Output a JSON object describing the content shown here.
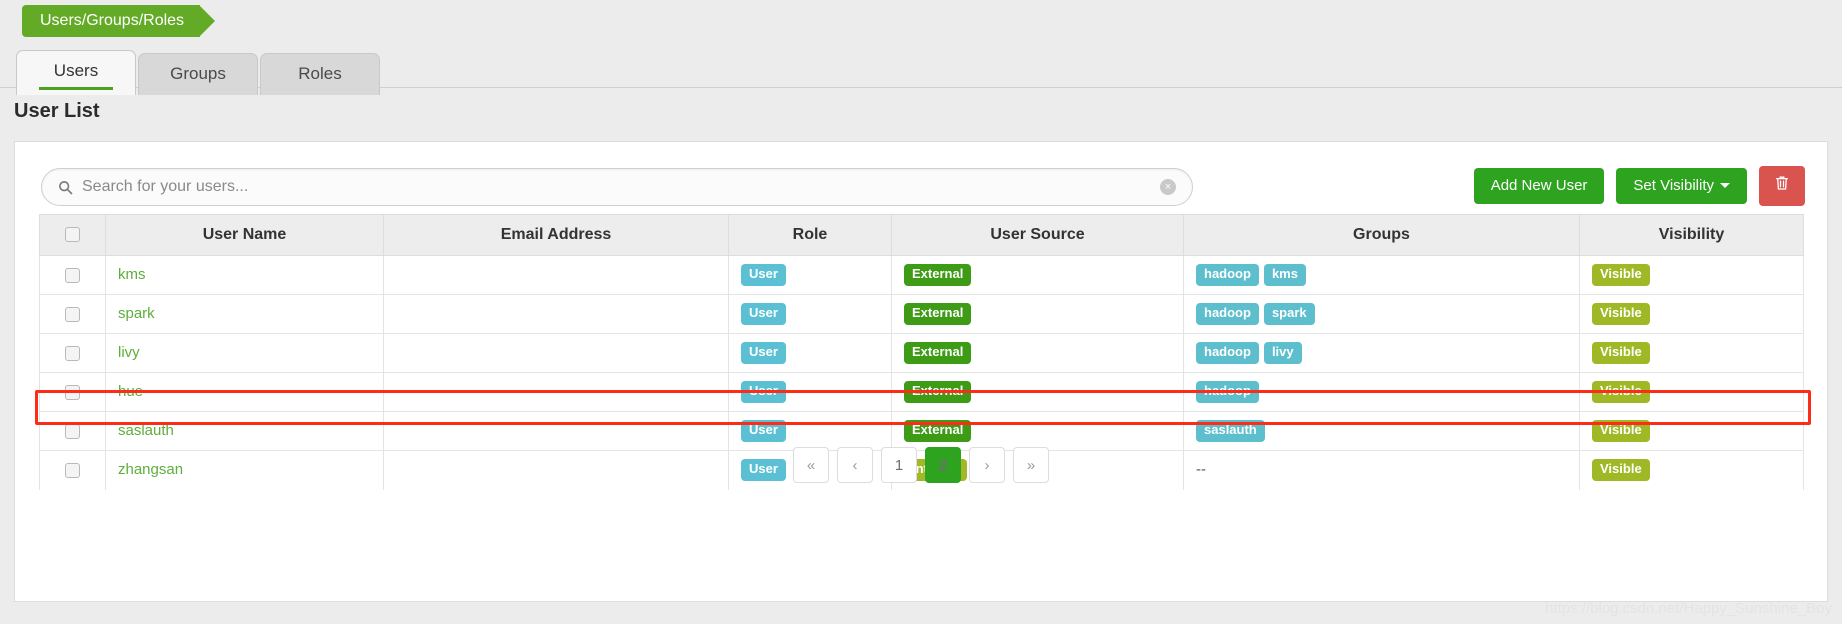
{
  "breadcrumb": {
    "label": "Users/Groups/Roles"
  },
  "tabs": [
    {
      "label": "Users",
      "active": true
    },
    {
      "label": "Groups",
      "active": false
    },
    {
      "label": "Roles",
      "active": false
    }
  ],
  "page_title": "User List",
  "search": {
    "placeholder": "Search for your users...",
    "value": "",
    "icon": "search-icon",
    "clear_icon": "×"
  },
  "toolbar": {
    "add_user_label": "Add New User",
    "set_visibility_label": "Set Visibility",
    "delete_icon": "trash-icon"
  },
  "table": {
    "columns": [
      "",
      "User Name",
      "Email Address",
      "Role",
      "User Source",
      "Groups",
      "Visibility"
    ],
    "rows": [
      {
        "user": "kms",
        "email": "",
        "role": "User",
        "source": "External",
        "source_kind": "external",
        "groups": [
          "hadoop",
          "kms"
        ],
        "visibility": "Visible",
        "highlighted": false
      },
      {
        "user": "spark",
        "email": "",
        "role": "User",
        "source": "External",
        "source_kind": "external",
        "groups": [
          "hadoop",
          "spark"
        ],
        "visibility": "Visible",
        "highlighted": false
      },
      {
        "user": "livy",
        "email": "",
        "role": "User",
        "source": "External",
        "source_kind": "external",
        "groups": [
          "hadoop",
          "livy"
        ],
        "visibility": "Visible",
        "highlighted": false
      },
      {
        "user": "hue",
        "email": "",
        "role": "User",
        "source": "External",
        "source_kind": "external",
        "groups": [
          "hadoop"
        ],
        "visibility": "Visible",
        "highlighted": false
      },
      {
        "user": "saslauth",
        "email": "",
        "role": "User",
        "source": "External",
        "source_kind": "external",
        "groups": [
          "saslauth"
        ],
        "visibility": "Visible",
        "highlighted": false
      },
      {
        "user": "zhangsan",
        "email": "",
        "role": "User",
        "source": "Internal",
        "source_kind": "internal",
        "groups": [],
        "groups_empty": "--",
        "visibility": "Visible",
        "highlighted": true
      }
    ]
  },
  "pagination": {
    "items": [
      {
        "label": "«",
        "name": "first",
        "active": false
      },
      {
        "label": "‹",
        "name": "prev",
        "active": false
      },
      {
        "label": "1",
        "name": "page-1",
        "active": false
      },
      {
        "label": "2",
        "name": "page-2",
        "active": true
      },
      {
        "label": "›",
        "name": "next",
        "active": false
      },
      {
        "label": "»",
        "name": "last",
        "active": false
      }
    ]
  },
  "watermark": "https://blog.csdn.net/Happy_Sunshine_Boy",
  "colors": {
    "brand_green": "#63ab26",
    "button_green": "#2ea320",
    "danger_red": "#d9534f",
    "badge_role": "#5bc0d4",
    "badge_external": "#3d9b16",
    "badge_internal": "#a2b828",
    "badge_group": "#5dbecd",
    "badge_visible": "#9fb825",
    "highlight_outline": "#fb2d19",
    "link_green": "#5eae3c"
  }
}
